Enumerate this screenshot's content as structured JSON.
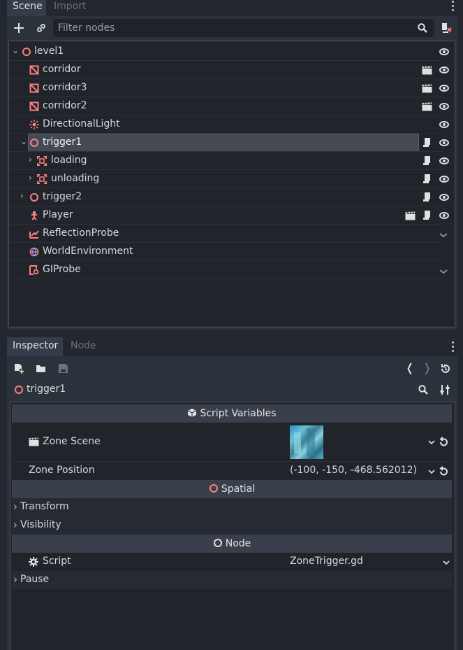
{
  "scene_dock": {
    "tabs": [
      "Scene",
      "Import"
    ],
    "filter_placeholder": "Filter nodes",
    "nodes": [
      {
        "label": "level1"
      },
      {
        "label": "corridor"
      },
      {
        "label": "corridor3"
      },
      {
        "label": "corridor2"
      },
      {
        "label": "DirectionalLight"
      },
      {
        "label": "trigger1"
      },
      {
        "label": "loading"
      },
      {
        "label": "unloading"
      },
      {
        "label": "trigger2"
      },
      {
        "label": "Player"
      },
      {
        "label": "ReflectionProbe"
      },
      {
        "label": "WorldEnvironment"
      },
      {
        "label": "GIProbe"
      }
    ]
  },
  "inspector": {
    "tabs": [
      "Inspector",
      "Node"
    ],
    "object_name": "trigger1",
    "sections": {
      "script_variables": "Script Variables",
      "spatial": "Spatial",
      "node": "Node"
    },
    "props": {
      "zone_scene": "Zone Scene",
      "zone_position": "Zone Position",
      "zone_position_value": "(-100, -150, -468.562012)",
      "transform": "Transform",
      "visibility": "Visibility",
      "script": "Script",
      "script_value": "ZoneTrigger.gd",
      "pause": "Pause"
    }
  },
  "colors": {
    "accent_red": "#fc7f7f",
    "panel": "#2c323c",
    "background": "#222730"
  }
}
